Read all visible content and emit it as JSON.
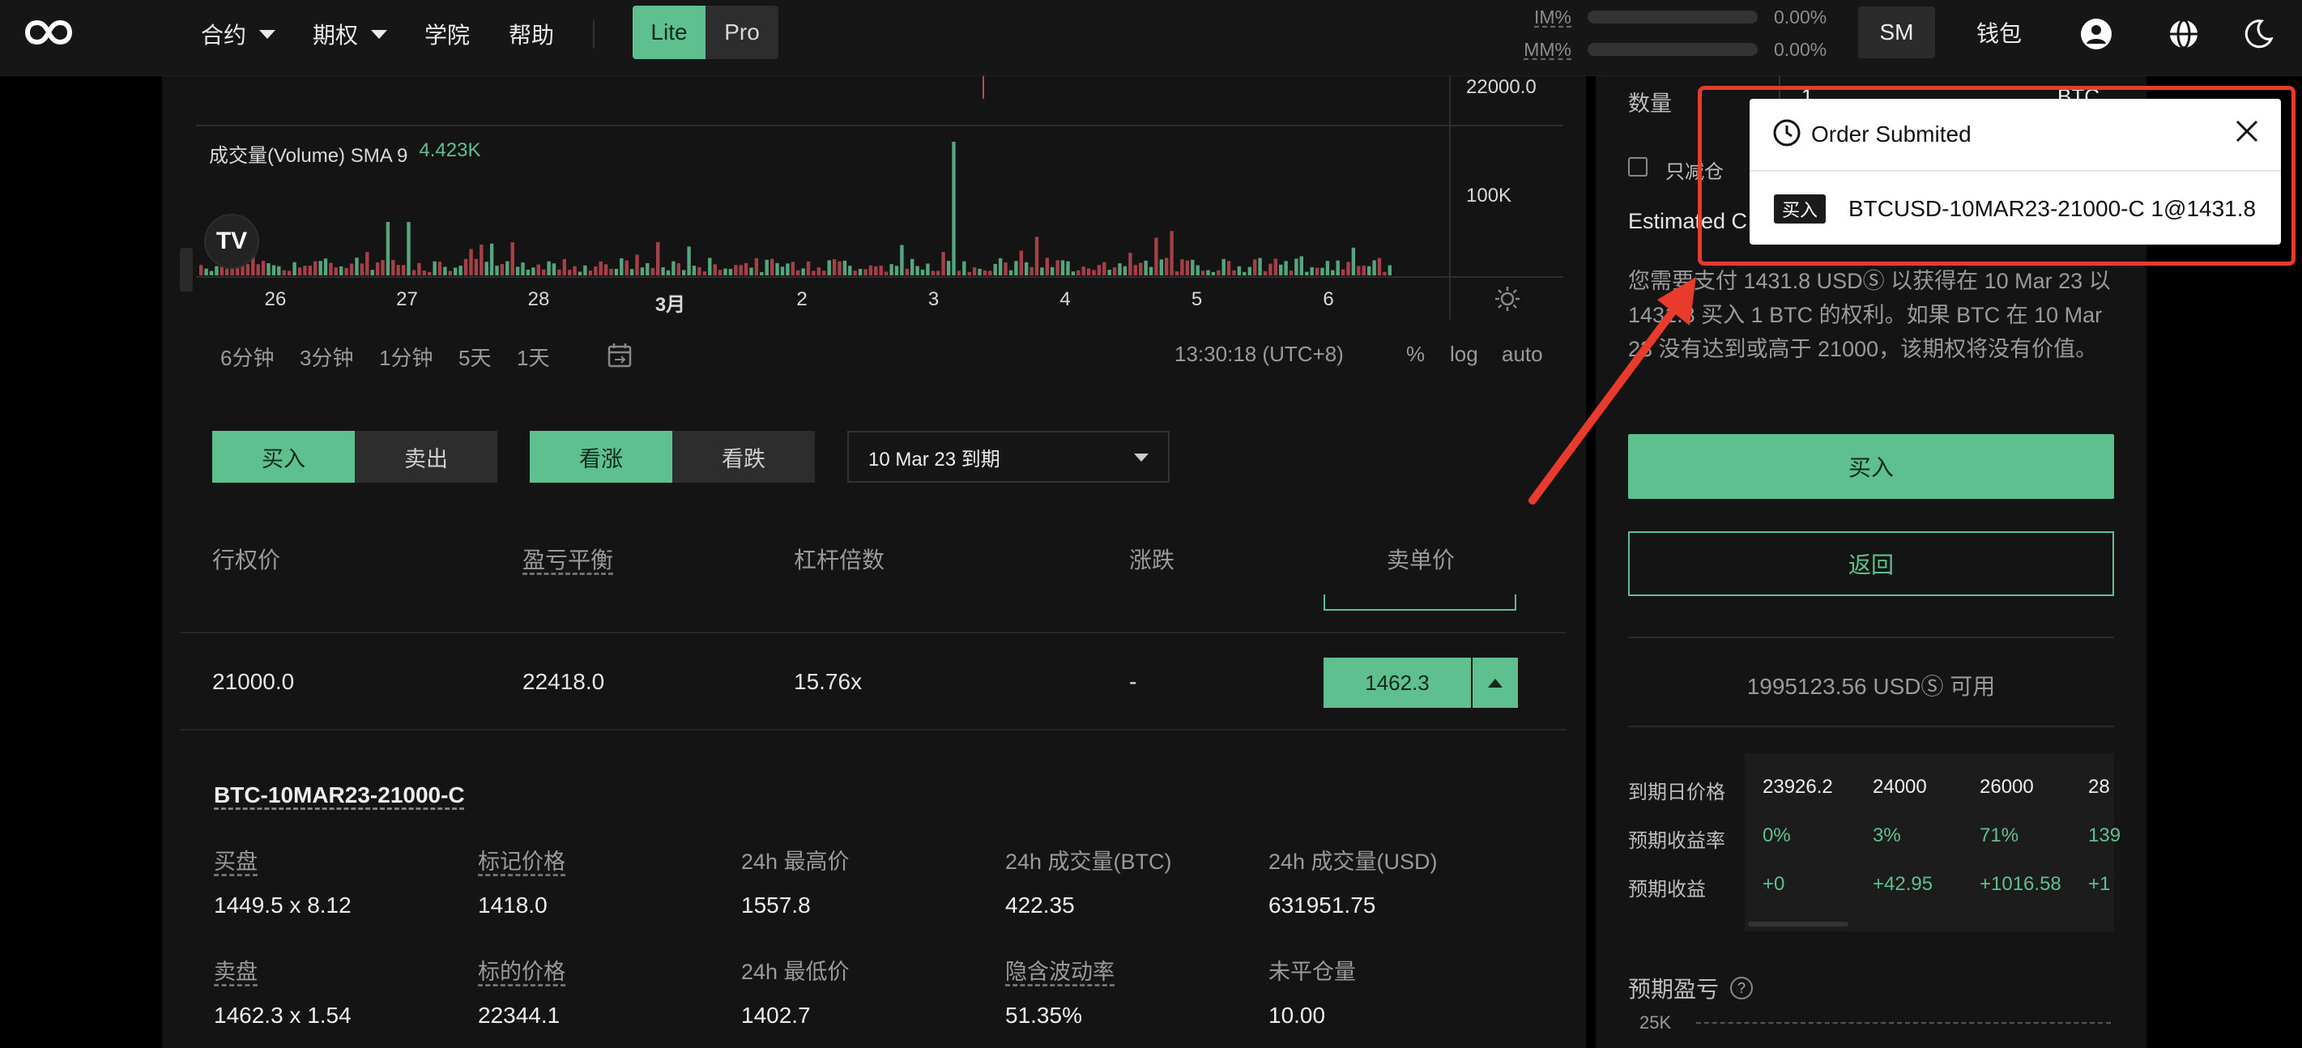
{
  "nav": {
    "items": [
      {
        "label": "合约",
        "has_caret": true
      },
      {
        "label": "期权",
        "has_caret": true
      },
      {
        "label": "学院",
        "has_caret": false
      },
      {
        "label": "帮助",
        "has_caret": false
      }
    ],
    "mode": {
      "lite": "Lite",
      "pro": "Pro",
      "active": "Lite"
    },
    "margins": [
      {
        "label": "IM%",
        "value": "0.00%"
      },
      {
        "label": "MM%",
        "value": "0.00%"
      }
    ],
    "account": "SM",
    "wallet": "钱包",
    "icons": [
      "user-icon",
      "globe-icon",
      "moon-icon"
    ]
  },
  "chart": {
    "price_label_top": "22000.0",
    "volume_axis_label": "100K",
    "volume_legend": {
      "name": "成交量(Volume) SMA 9",
      "value": "4.423K"
    },
    "logo": "TV",
    "x_ticks": [
      {
        "label": "26",
        "bold": false
      },
      {
        "label": "27",
        "bold": false
      },
      {
        "label": "28",
        "bold": false
      },
      {
        "label": "3月",
        "bold": true
      },
      {
        "label": "2",
        "bold": false
      },
      {
        "label": "3",
        "bold": false
      },
      {
        "label": "4",
        "bold": false
      },
      {
        "label": "5",
        "bold": false
      },
      {
        "label": "6",
        "bold": false
      }
    ],
    "timeframes": [
      "6分钟",
      "3分钟",
      "1分钟",
      "5天",
      "1天"
    ],
    "time_readout": "13:30:18 (UTC+8)",
    "options": [
      "%",
      "log",
      "auto"
    ],
    "colors": {
      "up": "#5ec08f",
      "down": "#c0474f"
    }
  },
  "controls": {
    "side": {
      "buy": "买入",
      "sell": "卖出",
      "active": "buy"
    },
    "direction": {
      "call": "看涨",
      "put": "看跌",
      "active": "call"
    },
    "expiry": "10 Mar 23 到期"
  },
  "table": {
    "headers": [
      "行权价",
      "盈亏平衡",
      "杠杆倍数",
      "涨跌",
      "卖单价"
    ],
    "row": {
      "strike": "21000.0",
      "breakeven": "22418.0",
      "leverage": "15.76x",
      "change": "-",
      "ask": "1462.3"
    }
  },
  "contract": {
    "name": "BTC-10MAR23-21000-C",
    "stats": [
      {
        "label": "买盘",
        "value": "1449.5 x 8.12",
        "underline": true
      },
      {
        "label": "标记价格",
        "value": "1418.0",
        "underline": true
      },
      {
        "label": "24h 最高价",
        "value": "1557.8",
        "underline": false
      },
      {
        "label": "24h 成交量(BTC)",
        "value": "422.35",
        "underline": false
      },
      {
        "label": "24h 成交量(USD)",
        "value": "631951.75",
        "underline": false
      },
      {
        "label": "卖盘",
        "value": "1462.3 x 1.54",
        "underline": true
      },
      {
        "label": "标的价格",
        "value": "22344.1",
        "underline": true
      },
      {
        "label": "24h 最低价",
        "value": "1402.7",
        "underline": false
      },
      {
        "label": "隐含波动率",
        "value": "51.35%",
        "underline": true
      },
      {
        "label": "未平仓量",
        "value": "10.00",
        "underline": false
      }
    ]
  },
  "order_panel": {
    "quantity_label": "数量",
    "quantity_value": "1",
    "quantity_unit": "BTC",
    "reduce_only": "只减仓",
    "estimated_label": "Estimated C",
    "description": "您需要支付 1431.8 USDⓈ 以获得在 10 Mar 23 以 1431.8 买入 1 BTC 的权利。如果 BTC 在 10 Mar 23 没有达到或高于 21000，该期权将没有价值。",
    "buy_button": "买入",
    "back_button": "返回",
    "available": "1995123.56 USDⓈ 可用",
    "projection": {
      "row_labels": [
        "到期日价格",
        "预期收益率",
        "预期收益"
      ],
      "columns": [
        {
          "price": "23926.2",
          "rate": "0%",
          "pnl": "+0"
        },
        {
          "price": "24000",
          "rate": "3%",
          "pnl": "+42.95"
        },
        {
          "price": "26000",
          "rate": "71%",
          "pnl": "+1016.58"
        },
        {
          "price": "28",
          "rate": "139",
          "pnl": "+1"
        }
      ]
    },
    "pnl_title": "预期盈亏",
    "pnl_axis_top": "25K"
  },
  "toast": {
    "title": "Order Submited",
    "badge": "买入",
    "message": "BTCUSD-10MAR23-21000-C 1@1431.8"
  }
}
